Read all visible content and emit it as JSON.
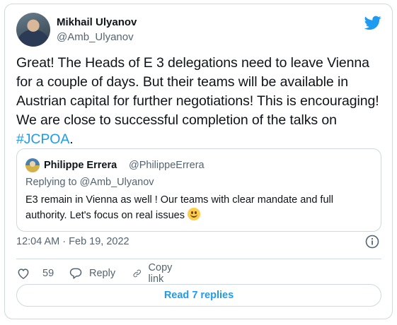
{
  "author": {
    "name": "Mikhail Ulyanov",
    "handle": "@Amb_Ulyanov"
  },
  "tweet": {
    "text_before": "Great! The Heads of E 3 delegations need to leave Vienna for a couple of days. But their teams will be available in Austrian capital for further negotiations! This is encouraging! We are close to successful completion of the talks on ",
    "hashtag": "#JCPOA",
    "text_after": ".",
    "timestamp": "12:04 AM · Feb 19, 2022"
  },
  "quoted": {
    "name": "Philippe Errera",
    "handle": "@PhilippeErrera",
    "replying_to": "Replying to @Amb_Ulyanov",
    "text": "E3 remain in Vienna as well ! Our teams with clear mandate and full authority. Let's focus on real issues "
  },
  "actions": {
    "like_count": "59",
    "reply_label": "Reply",
    "copy_label": "Copy link"
  },
  "read_replies_label": "Read 7 replies",
  "icons": [
    "twitter-logo-icon",
    "info-icon",
    "heart-icon",
    "reply-bubble-icon",
    "link-icon",
    "smile-emoji-icon"
  ],
  "colors": {
    "accent": "#1d9bf0",
    "text": "#0f1419",
    "secondary": "#536471",
    "border": "#cfd9de"
  }
}
